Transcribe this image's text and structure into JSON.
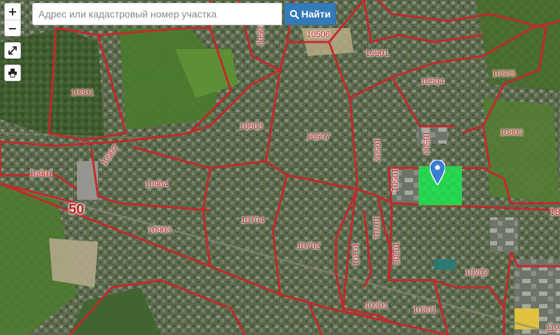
{
  "search": {
    "placeholder": "Адрес или кадастровый номер участка",
    "button_label": "Найти"
  },
  "controls": {
    "zoom_in": "+",
    "zoom_out": "−"
  },
  "map": {
    "type": "satellite",
    "boundary_color": "#c8262b",
    "parcel_color": "#1eeb55",
    "road_number": "50",
    "quarters": [
      {
        "label": "10506"
      },
      {
        "label": "10501"
      },
      {
        "label": "10505"
      },
      {
        "label": "10504"
      },
      {
        "label": "10801"
      },
      {
        "label": "10803"
      },
      {
        "label": "10507"
      },
      {
        "label": "10802"
      },
      {
        "label": "10902"
      },
      {
        "label": "10503"
      },
      {
        "label": "10502"
      },
      {
        "label": "10901"
      },
      {
        "label": "10904"
      },
      {
        "label": "10501"
      },
      {
        "label": "10903"
      },
      {
        "label": "10704"
      },
      {
        "label": "10702"
      },
      {
        "label": "10701"
      },
      {
        "label": "10101"
      },
      {
        "label": "10202"
      },
      {
        "label": "10202"
      },
      {
        "label": "10301"
      },
      {
        "label": "10301"
      },
      {
        "label": "1"
      },
      {
        "label": "112"
      },
      {
        "label": "10502"
      },
      {
        "label": "18"
      }
    ]
  }
}
